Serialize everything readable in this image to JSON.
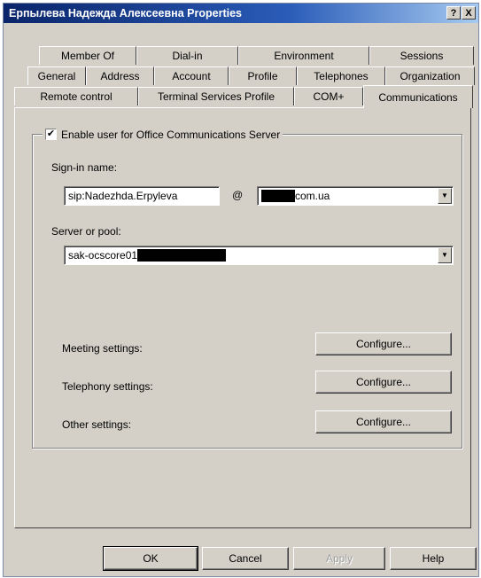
{
  "window": {
    "title": "Ерпылева Надежда Алексеевна Properties",
    "help_btn": "?",
    "close_btn": "X"
  },
  "tabs": {
    "row1": [
      "Member Of",
      "Dial-in",
      "Environment",
      "Sessions"
    ],
    "row2": [
      "General",
      "Address",
      "Account",
      "Profile",
      "Telephones",
      "Organization"
    ],
    "row3": [
      "Remote control",
      "Terminal Services Profile",
      "COM+",
      "Communications"
    ],
    "active": "Communications"
  },
  "ocs": {
    "enable_label": "Enable user for Office Communications Server",
    "enabled": true,
    "signin_label": "Sign-in name:",
    "signin_value": "sip:Nadezhda.Erpyleva",
    "at_symbol": "@",
    "domain_value_suffix": "com.ua",
    "server_label": "Server or pool:",
    "server_value_prefix": "sak-ocscore01",
    "meeting_label": "Meeting settings:",
    "telephony_label": "Telephony settings:",
    "other_label": "Other settings:",
    "configure_meeting": "Configure...",
    "configure_telephony": "Configure...",
    "configure_other": "Configure..."
  },
  "footer": {
    "ok": "OK",
    "cancel": "Cancel",
    "apply": "Apply",
    "help": "Help"
  }
}
